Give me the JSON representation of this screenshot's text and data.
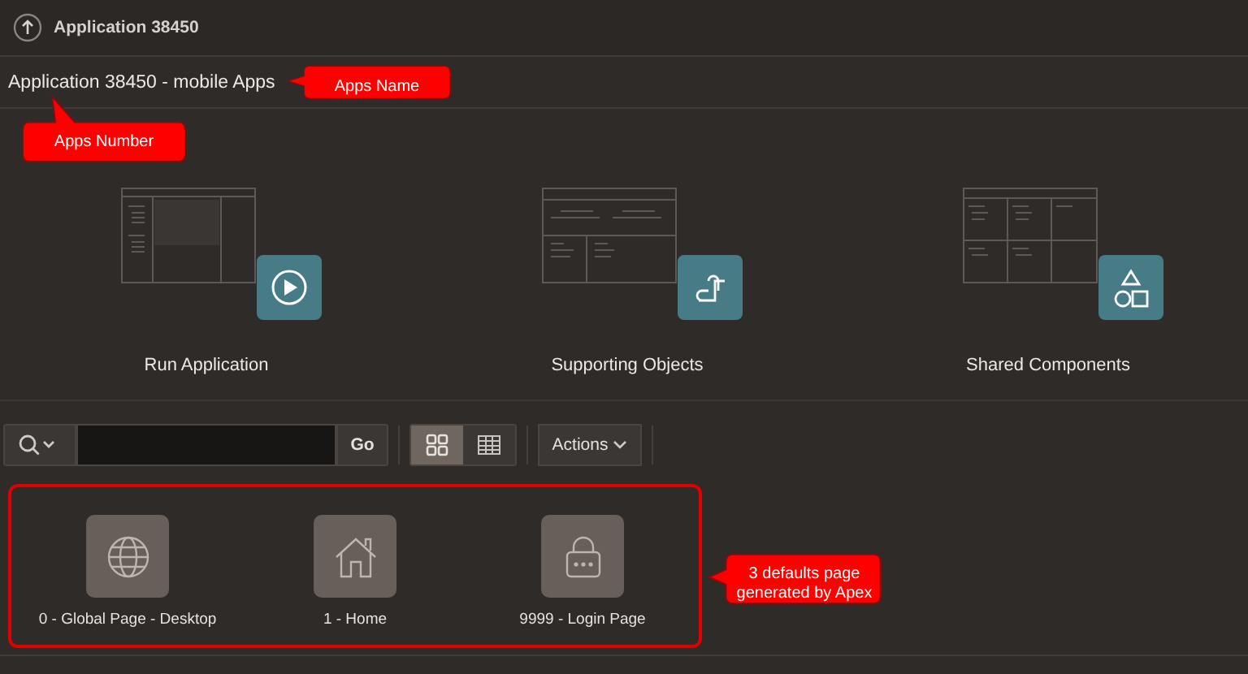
{
  "header": {
    "title": "Application 38450"
  },
  "app_heading": "Application 38450 - mobile Apps",
  "tiles": [
    {
      "label": "Run Application"
    },
    {
      "label": "Supporting Objects"
    },
    {
      "label": "Shared Components"
    }
  ],
  "toolbar": {
    "go": "Go",
    "views": [
      {
        "kind": "icons",
        "selected": true
      },
      {
        "kind": "report",
        "selected": false
      }
    ],
    "actions": "Actions"
  },
  "pages": [
    {
      "label": "0 - Global Page - Desktop"
    },
    {
      "label": "1 - Home"
    },
    {
      "label": "9999 - Login Page"
    }
  ],
  "annotations": [
    {
      "text": "Apps Name",
      "kind": "left"
    },
    {
      "text": "Apps Number",
      "kind": "up"
    },
    {
      "text": "3 defaults page generated by Apex",
      "kind": "left"
    }
  ]
}
